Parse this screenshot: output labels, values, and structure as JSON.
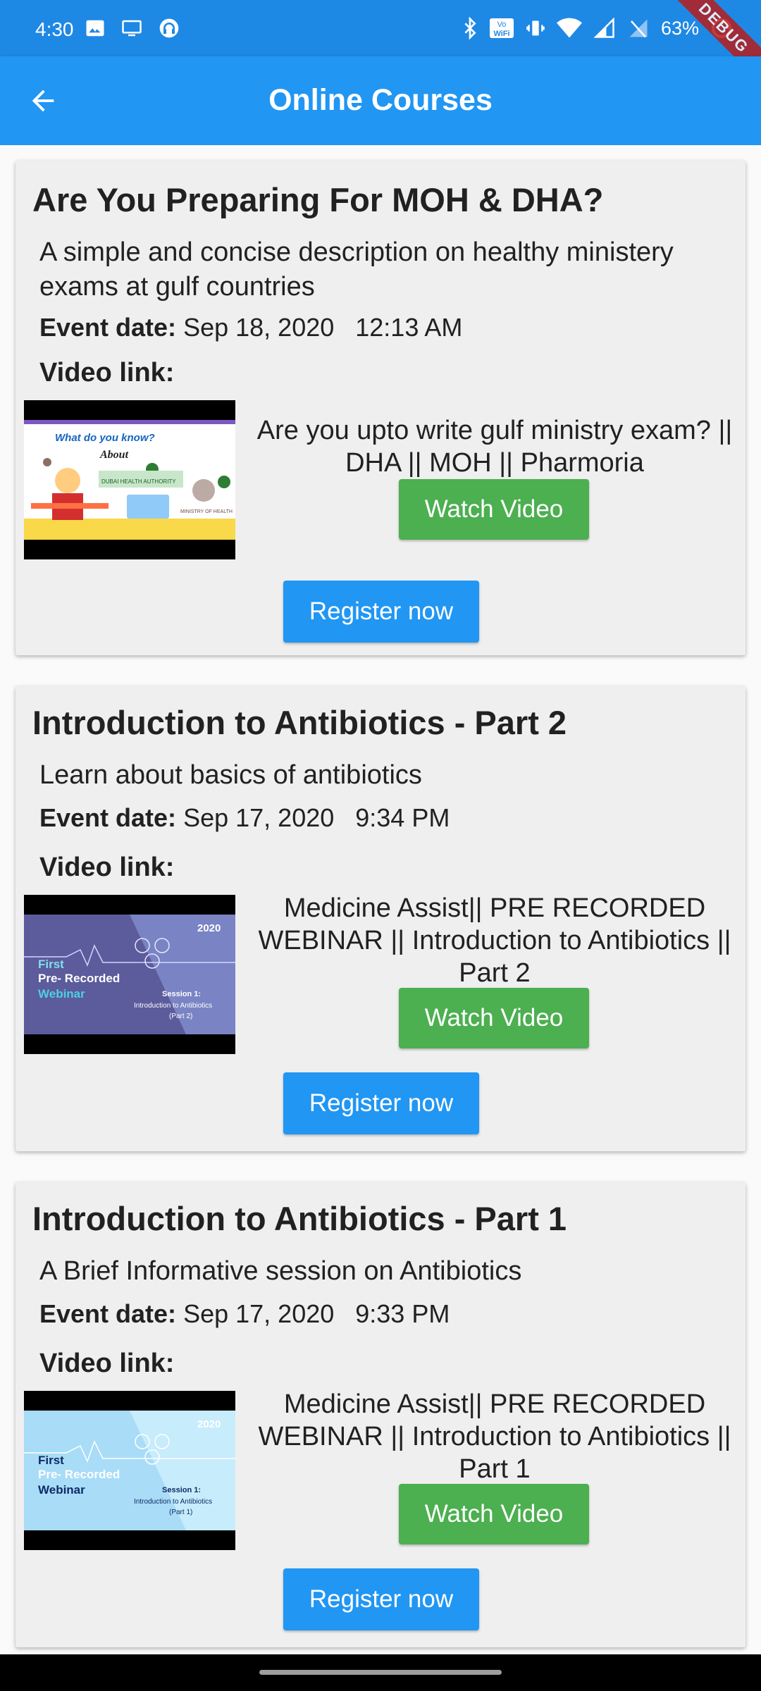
{
  "status_bar": {
    "time": "4:30",
    "battery": "63%",
    "debug_label": "DEBUG"
  },
  "app_bar": {
    "title": "Online Courses"
  },
  "common": {
    "event_date_label": "Event date:",
    "video_link_label": "Video link:",
    "watch_label": "Watch Video",
    "register_label": "Register now"
  },
  "courses": [
    {
      "title": "Are You Preparing For MOH & DHA?",
      "description": "A simple and concise description on healthy ministery exams at gulf countries",
      "event_date": "Sep 18, 2020   12:13 AM",
      "video_title": "Are you upto write gulf ministry exam? || DHA || MOH || Pharmoria",
      "thumbnail": {
        "line1": "What do you know?",
        "line2": "About",
        "authority": "DUBAI HEALTH AUTHORITY",
        "ministry": "MINISTRY OF HEALTH"
      }
    },
    {
      "title": "Introduction to Antibiotics - Part 2",
      "description": "Learn about basics of antibiotics",
      "event_date": "Sep 17, 2020   9:34 PM",
      "video_title": "Medicine Assist|| PRE RECORDED WEBINAR || Introduction to Antibiotics || Part 2",
      "thumbnail": {
        "year": "2020",
        "line1": "First",
        "line2": "Pre- Recorded",
        "line3": "Webinar",
        "session": "Session 1:",
        "topic": "Introduction to Antibiotics",
        "part": "(Part 2)"
      }
    },
    {
      "title": "Introduction to Antibiotics - Part 1",
      "description": "A Brief Informative session on Antibiotics",
      "event_date": "Sep 17, 2020   9:33 PM",
      "video_title": "Medicine Assist|| PRE RECORDED WEBINAR || Introduction to Antibiotics || Part 1",
      "thumbnail": {
        "year": "2020",
        "line1": "First",
        "line2": "Pre- Recorded",
        "line3": "Webinar",
        "session": "Session 1:",
        "topic": "Introduction to Antibiotics",
        "part": "(Part 1)"
      }
    }
  ],
  "colors": {
    "primary": "#2196f3",
    "status_bar": "#1e88e5",
    "watch_button": "#4caf50",
    "card_bg": "#efefef"
  }
}
